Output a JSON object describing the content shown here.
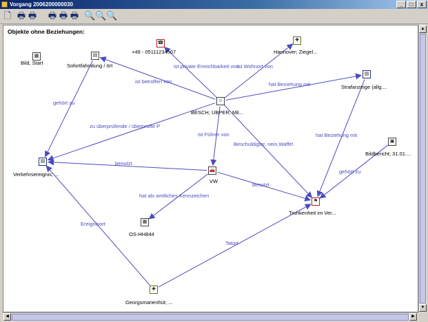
{
  "window": {
    "title": "Vorgang 2006200000030",
    "min": "_",
    "max": "□",
    "close": "x"
  },
  "toolbar": {
    "tools": [
      {
        "name": "new-document-icon",
        "glyph": "🗋"
      },
      {
        "name": "print-icon",
        "glyph": "🖶"
      },
      {
        "name": "print-edit-icon",
        "glyph": "🖶"
      },
      {
        "name": "print-all-icon",
        "glyph": "🖶"
      },
      {
        "name": "print-selection-icon",
        "glyph": "🖶"
      },
      {
        "name": "print-preview-icon",
        "glyph": "🖶"
      },
      {
        "name": "zoom-in-icon",
        "glyph": "🔍"
      },
      {
        "name": "zoom-out-icon",
        "glyph": "🔍"
      },
      {
        "name": "zoom-fit-icon",
        "glyph": "🔍"
      }
    ]
  },
  "heading": "Objekte ohne Beziehungen:",
  "nodes": [
    {
      "id": "bild",
      "label": "Bild, Start",
      "icon": "image-icon",
      "glyph": "▦",
      "border": "#404040"
    },
    {
      "id": "phone",
      "label": "+49 - 05111234567",
      "icon": "phone-number-icon",
      "glyph": "☎",
      "border": "#b02020"
    },
    {
      "id": "hannover",
      "label": "Hannover;  Ziegel...",
      "icon": "address-icon",
      "glyph": "✚",
      "border": "#607020"
    },
    {
      "id": "sofort",
      "label": "Sofortfahndung / ört",
      "icon": "search-document-icon",
      "glyph": "▤",
      "border": "#404040"
    },
    {
      "id": "strafanzeige",
      "label": "Strafanzeige (allg....",
      "icon": "report-document-icon",
      "glyph": "▤",
      "border": "#203080"
    },
    {
      "id": "besch",
      "label": "BESCH, UBPER;  Mil...",
      "icon": "person-icon",
      "glyph": "☺",
      "border": "#404040"
    },
    {
      "id": "bildbericht",
      "label": "Bildbericht; 31.01....",
      "icon": "photo-report-icon",
      "glyph": "▣",
      "border": "#404040"
    },
    {
      "id": "verkehr",
      "label": "Verkehrsereignis; ...",
      "icon": "traffic-event-icon",
      "glyph": "▤",
      "border": "#203080"
    },
    {
      "id": "vw",
      "label": "VW",
      "icon": "car-icon",
      "glyph": "🚗",
      "border": "#404040"
    },
    {
      "id": "trunkenheit",
      "label": "Trunkenheit im Ver...",
      "icon": "offense-icon",
      "glyph": "⚑",
      "border": "#b02020"
    },
    {
      "id": "kennzeichen",
      "label": "OS-HH844",
      "icon": "license-plate-icon",
      "glyph": "▦",
      "border": "#404040"
    },
    {
      "id": "georgs",
      "label": "Georgsmarienhüt; ...",
      "icon": "location-icon",
      "glyph": "✚",
      "border": "#607020"
    }
  ],
  "edges": [
    {
      "from": "besch",
      "to": "phone",
      "label": "ist private Erreichbarkeit von"
    },
    {
      "from": "besch",
      "to": "hannover",
      "label": "ist Wohnort von"
    },
    {
      "from": "besch",
      "to": "sofort",
      "label": "ist betroffen von"
    },
    {
      "from": "besch",
      "to": "strafanzeige",
      "label": "hat Beziehung mit"
    },
    {
      "from": "besch",
      "to": "verkehr",
      "label": "zu überprüfende / überprüfte P"
    },
    {
      "from": "besch",
      "to": "vw",
      "label": "ist Führer von"
    },
    {
      "from": "besch",
      "to": "trunkenheit",
      "label": "Beschuldigter, nein,Waffe!"
    },
    {
      "from": "sofort",
      "to": "verkehr",
      "label": "gehört zu"
    },
    {
      "from": "strafanzeige",
      "to": "trunkenheit",
      "label": "hat Beziehung mit"
    },
    {
      "from": "vw",
      "to": "verkehr",
      "label": "benutzt"
    },
    {
      "from": "vw",
      "to": "trunkenheit",
      "label": "benutzt"
    },
    {
      "from": "vw",
      "to": "kennzeichen",
      "label": "hat als amtliches Kennzeichen"
    },
    {
      "from": "bildbericht",
      "to": "trunkenheit",
      "label": "gehört zu"
    },
    {
      "from": "georgs",
      "to": "verkehr",
      "label": "Ereignisort"
    },
    {
      "from": "georgs",
      "to": "trunkenheit",
      "label": "Tatort"
    }
  ],
  "colors": {
    "edge": "#4b4bbf",
    "selection": "#c6c7e8"
  }
}
